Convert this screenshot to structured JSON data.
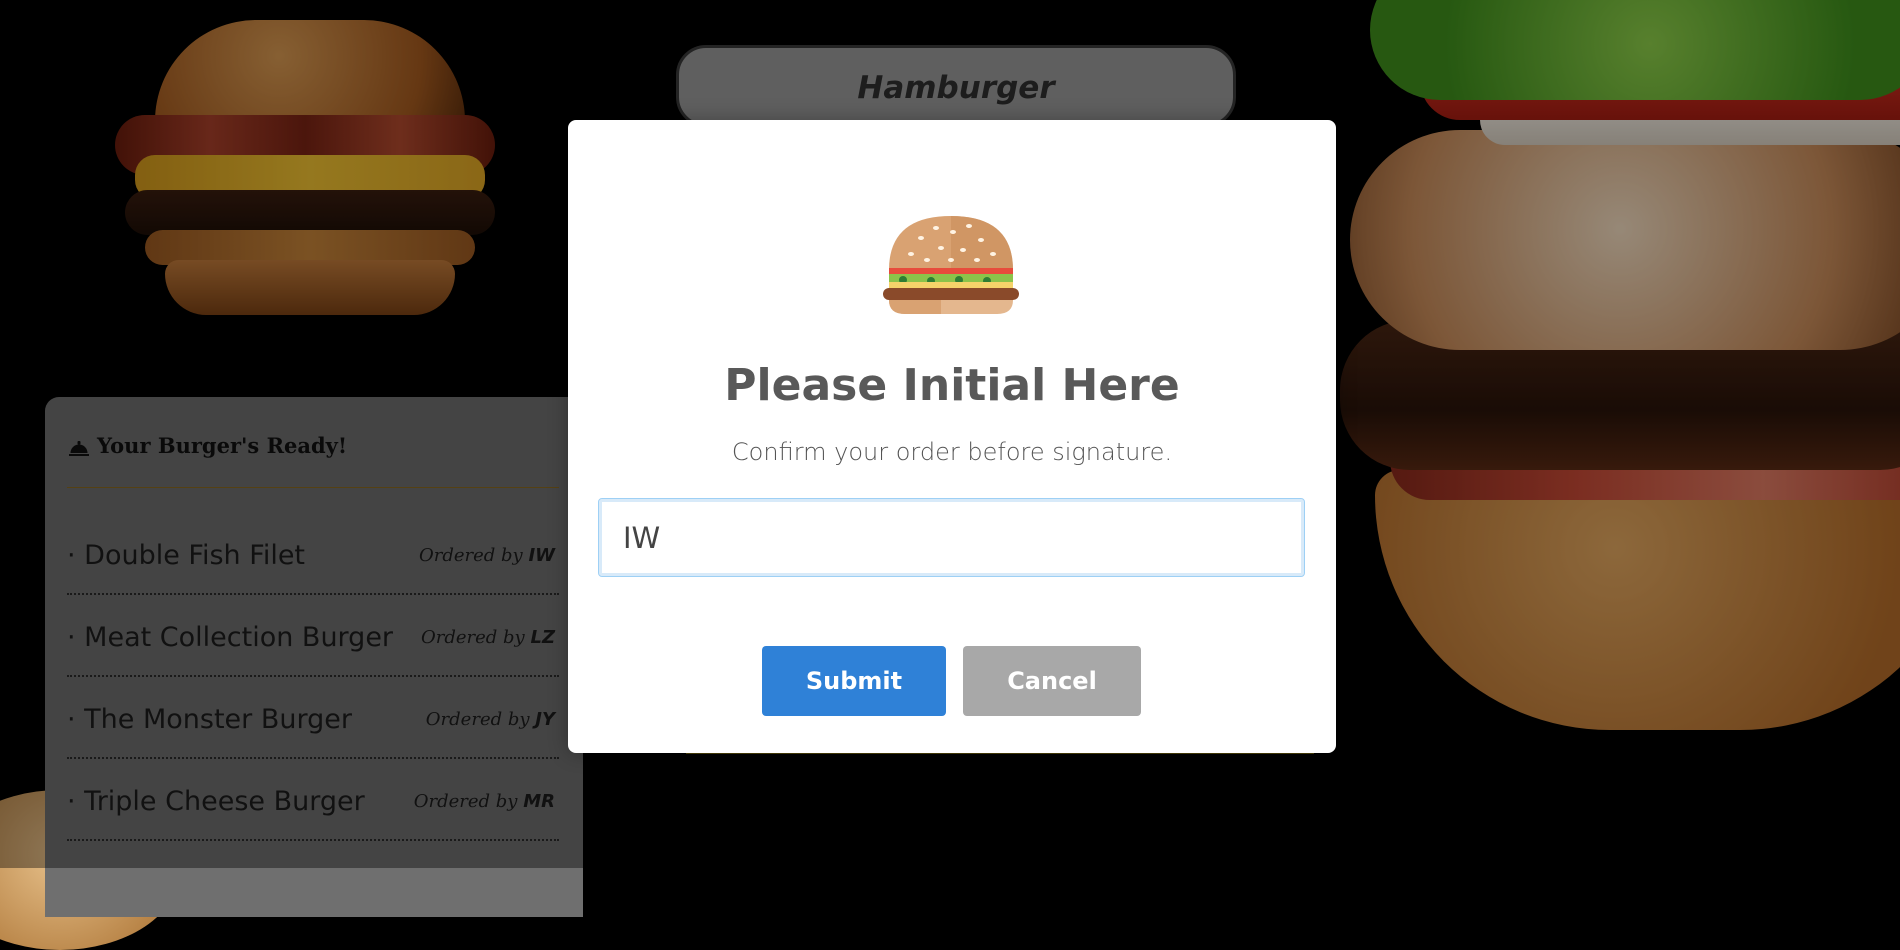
{
  "page": {
    "title": "Hamburger"
  },
  "ready_panel": {
    "heading": "Your Burger's Ready!",
    "heading_icon": "bell-icon",
    "ordered_by_label": "Ordered by",
    "items": [
      {
        "name": "· Double Fish Filet",
        "initials": "IW"
      },
      {
        "name": "· Meat Collection Burger",
        "initials": "LZ"
      },
      {
        "name": "· The Monster Burger",
        "initials": "JY"
      },
      {
        "name": "· Triple Cheese Burger",
        "initials": "MR"
      }
    ]
  },
  "modal": {
    "icon": "hamburger-icon",
    "title": "Please Initial Here",
    "subtitle": "Confirm your order before signature.",
    "input_value": "IW",
    "submit_label": "Submit",
    "cancel_label": "Cancel"
  },
  "colors": {
    "submit": "#2f81d7",
    "cancel": "#a8a8a8",
    "overlay": "rgba(0,0,0,0.38)"
  }
}
